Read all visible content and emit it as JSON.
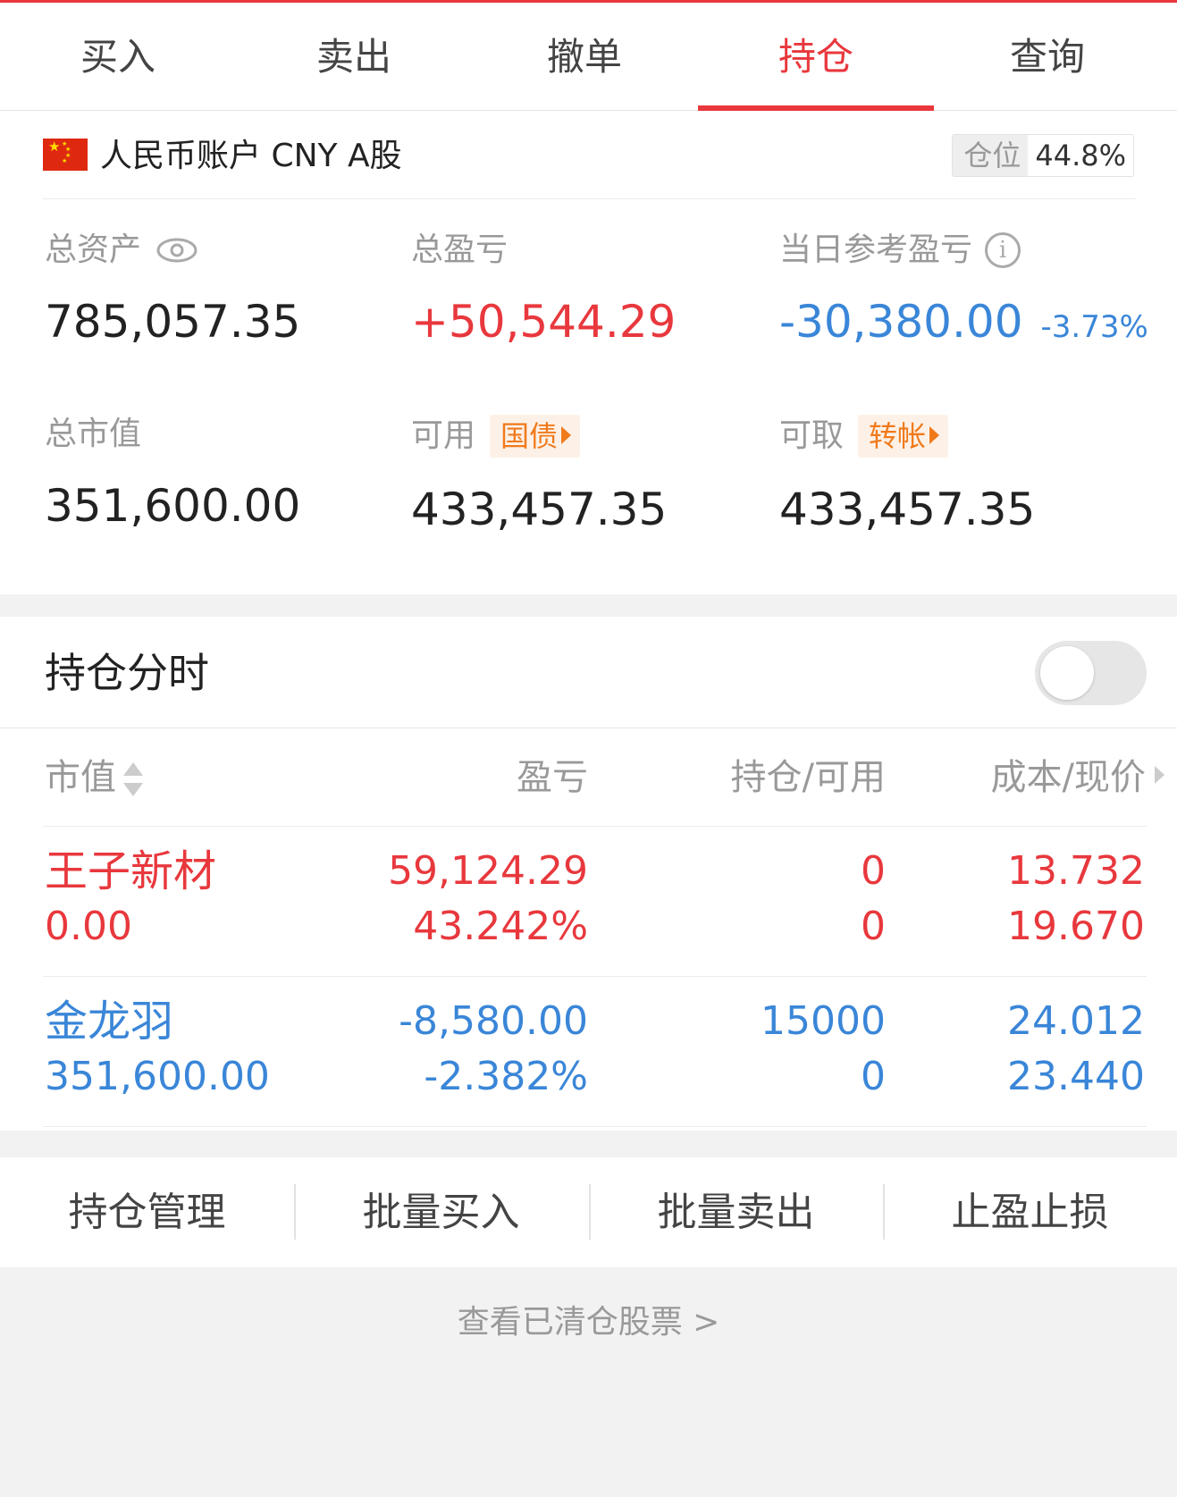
{
  "tabs": [
    {
      "label": "买入"
    },
    {
      "label": "卖出"
    },
    {
      "label": "撤单"
    },
    {
      "label": "持仓",
      "active": true
    },
    {
      "label": "查询"
    }
  ],
  "account": {
    "title": "人民币账户 CNY A股",
    "position_label": "仓位",
    "position_value": "44.8%",
    "stats": {
      "total_assets": {
        "label": "总资产",
        "value": "785,057.35"
      },
      "total_pnl": {
        "label": "总盈亏",
        "value": "+50,544.29"
      },
      "daily_pnl": {
        "label": "当日参考盈亏",
        "value": "-30,380.00",
        "pct": "-3.73%"
      },
      "market_value": {
        "label": "总市值",
        "value": "351,600.00"
      },
      "available": {
        "label": "可用",
        "tag": "国债",
        "value": "433,457.35"
      },
      "withdrawable": {
        "label": "可取",
        "tag": "转帐",
        "value": "433,457.35"
      }
    }
  },
  "timeline": {
    "label": "持仓分时",
    "enabled": false
  },
  "table": {
    "headers": {
      "market_value": "市值",
      "pnl": "盈亏",
      "holdings": "持仓/可用",
      "price": "成本/现价"
    },
    "rows": [
      {
        "name": "王子新材",
        "market_value": "0.00",
        "pnl": "59,124.29",
        "pnl_pct": "43.242%",
        "holding": "0",
        "available": "0",
        "cost": "13.732",
        "price": "19.670",
        "color": "#e8383d"
      },
      {
        "name": "金龙羽",
        "market_value": "351,600.00",
        "pnl": "-8,580.00",
        "pnl_pct": "-2.382%",
        "holding": "15000",
        "available": "0",
        "cost": "24.012",
        "price": "23.440",
        "color": "#3a86d8"
      }
    ]
  },
  "actions": [
    {
      "label": "持仓管理"
    },
    {
      "label": "批量买入"
    },
    {
      "label": "批量卖出"
    },
    {
      "label": "止盈止损"
    }
  ],
  "cleared_link": "查看已清仓股票 >",
  "colors": {
    "accent": "#e8383d",
    "gain": "#e8383d",
    "loss": "#3a86d8",
    "tag": "#f07a1b"
  }
}
